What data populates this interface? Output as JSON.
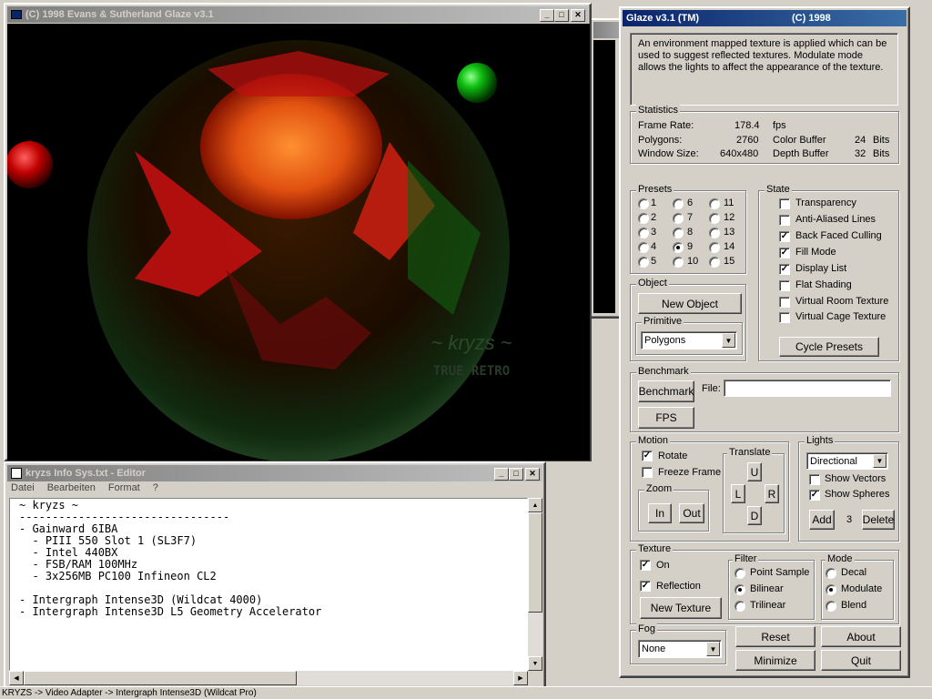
{
  "render_window": {
    "title": "(C) 1998 Evans & Sutherland  Glaze v3.1",
    "watermark_main": "~ kryzs ~",
    "watermark_sub": "TRUE RETRO"
  },
  "editor": {
    "title": "kryzs Info Sys.txt - Editor",
    "menu": [
      "Datei",
      "Bearbeiten",
      "Format",
      "?"
    ],
    "lines": [
      "~ kryzs ~",
      "--------------------------------",
      "- Gainward 6IBA",
      "  - PIII 550 Slot 1 (SL3F7)",
      "  - Intel 440BX",
      "  - FSB/RAM 100MHz",
      "  - 3x256MB PC100 Infineon CL2",
      "",
      "- Intergraph Intense3D (Wildcat 4000)",
      "- Intergraph Intense3D L5 Geometry Accelerator"
    ]
  },
  "statusbar": {
    "text": "KRYZS -> Video Adapter -> Intergraph Intense3D (Wildcat Pro)"
  },
  "glaze": {
    "title": "Glaze v3.1 (TM)",
    "title_right": "(C) 1998",
    "description": "An environment mapped texture is applied which can be used to suggest reflected textures. Modulate mode allows the lights to affect the appearance of the texture.",
    "stats": {
      "label": "Statistics",
      "frame_rate_label": "Frame Rate:",
      "frame_rate": "178.4",
      "fps": "fps",
      "polygons_label": "Polygons:",
      "polygons": "2760",
      "color_buffer_label": "Color Buffer",
      "color_buffer": "24",
      "bits1": "Bits",
      "window_size_label": "Window Size:",
      "window_size": "640x480",
      "depth_buffer_label": "Depth Buffer",
      "depth_buffer": "32",
      "bits2": "Bits"
    },
    "presets": {
      "label": "Presets",
      "items": [
        "1",
        "2",
        "3",
        "4",
        "5",
        "6",
        "7",
        "8",
        "9",
        "10",
        "11",
        "12",
        "13",
        "14",
        "15"
      ],
      "selected": "9"
    },
    "state": {
      "label": "State",
      "items": [
        {
          "label": "Transparency",
          "checked": false
        },
        {
          "label": "Anti-Aliased Lines",
          "checked": false
        },
        {
          "label": "Back Faced Culling",
          "checked": true
        },
        {
          "label": "Fill Mode",
          "checked": true
        },
        {
          "label": "Display List",
          "checked": true
        },
        {
          "label": "Flat Shading",
          "checked": false
        },
        {
          "label": "Virtual Room Texture",
          "checked": false
        },
        {
          "label": "Virtual Cage Texture",
          "checked": false
        }
      ],
      "cycle_button": "Cycle Presets"
    },
    "object": {
      "label": "Object",
      "new_button": "New Object",
      "primitive_label": "Primitive",
      "primitive_value": "Polygons"
    },
    "benchmark": {
      "label": "Benchmark",
      "benchmark_button": "Benchmark",
      "file_label": "File:",
      "file_value": "",
      "fps_button": "FPS"
    },
    "motion": {
      "label": "Motion",
      "rotate": "Rotate",
      "rotate_checked": true,
      "freeze": "Freeze Frame",
      "freeze_checked": false,
      "zoom_label": "Zoom",
      "zoom_in": "In",
      "zoom_out": "Out",
      "translate_label": "Translate",
      "up": "U",
      "left": "L",
      "right": "R",
      "down": "D"
    },
    "lights": {
      "label": "Lights",
      "type_value": "Directional",
      "show_vectors": "Show Vectors",
      "show_vectors_checked": false,
      "show_spheres": "Show Spheres",
      "show_spheres_checked": true,
      "add_button": "Add",
      "count": "3",
      "delete_button": "Delete"
    },
    "texture": {
      "label": "Texture",
      "on": "On",
      "on_checked": true,
      "reflection": "Reflection",
      "reflection_checked": true,
      "new_button": "New Texture",
      "filter_label": "Filter",
      "filters": [
        "Point Sample",
        "Bilinear",
        "Trilinear"
      ],
      "filter_selected": "Bilinear",
      "mode_label": "Mode",
      "modes": [
        "Decal",
        "Modulate",
        "Blend"
      ],
      "mode_selected": "Modulate"
    },
    "fog": {
      "label": "Fog",
      "value": "None"
    },
    "buttons": {
      "reset": "Reset",
      "about": "About",
      "minimize": "Minimize",
      "quit": "Quit"
    }
  }
}
